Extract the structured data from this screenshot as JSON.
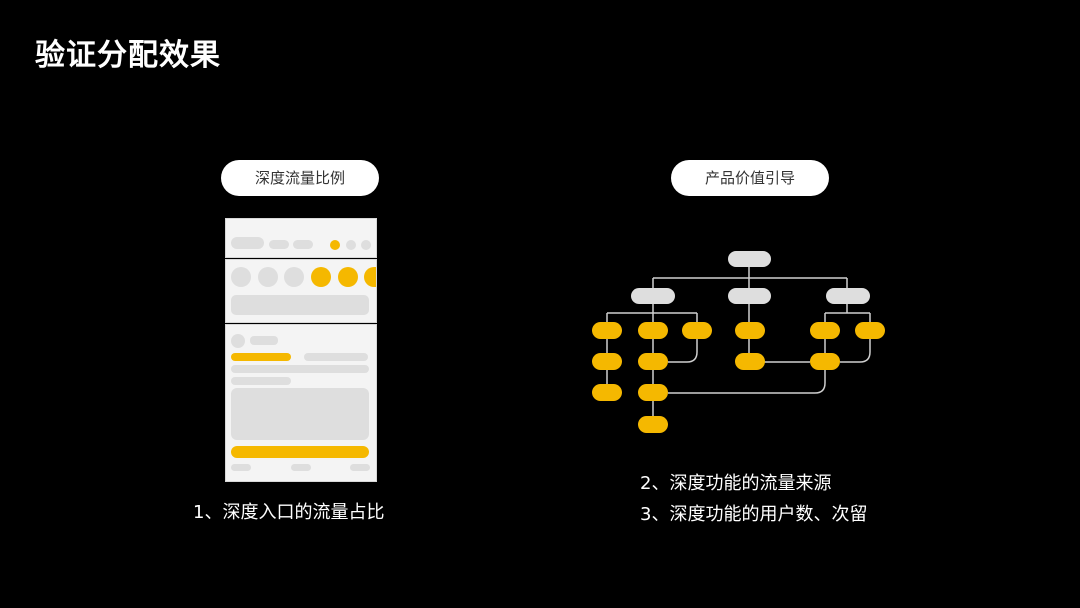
{
  "slide": {
    "title": "验证分配效果"
  },
  "left_panel": {
    "pill_label": "深度流量比例",
    "caption": "1、深度入口的流量占比"
  },
  "right_panel": {
    "pill_label": "产品价值引导",
    "captions": [
      "2、深度功能的流量来源",
      "3、深度功能的用户数、次留"
    ]
  },
  "colors": {
    "accent": "#f5b800",
    "placeholder": "#dedede",
    "line": "#cfcfcf",
    "background": "#000000"
  }
}
